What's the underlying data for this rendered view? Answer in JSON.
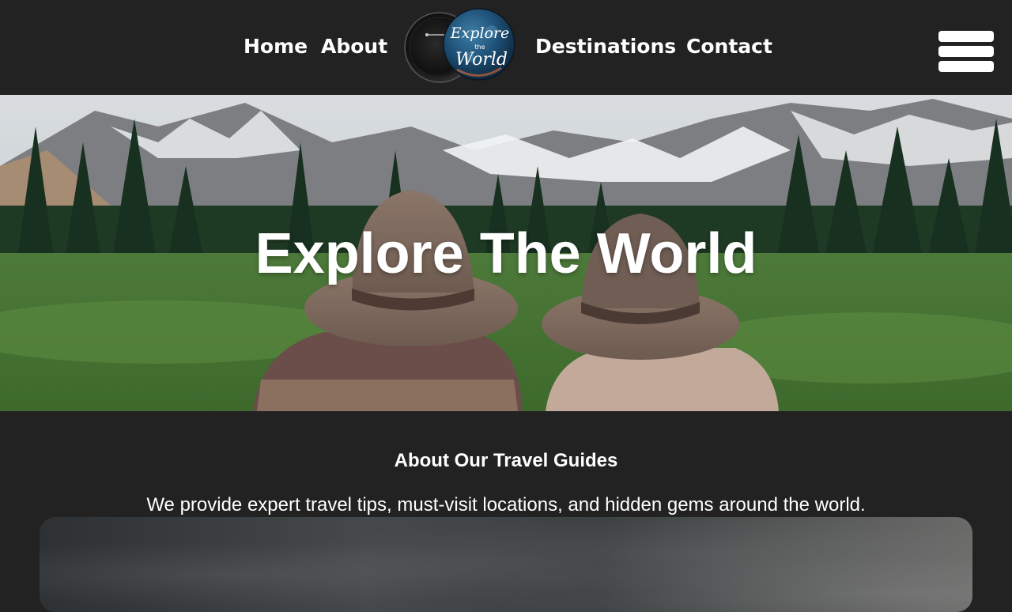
{
  "nav": {
    "home_label": "Home",
    "about_label": "About",
    "destinations_label": "Destinations",
    "contact_label": "Contact"
  },
  "logo": {
    "line1": "Explore",
    "line2": "the",
    "line3": "World"
  },
  "menu": {
    "icon": "hamburger-icon"
  },
  "hero": {
    "title": "Explore The World"
  },
  "about": {
    "title": "About Our Travel Guides",
    "text": "We provide expert travel tips, must-visit locations, and hidden gems around the world."
  },
  "colors": {
    "background": "#222222",
    "text": "#ffffff"
  }
}
